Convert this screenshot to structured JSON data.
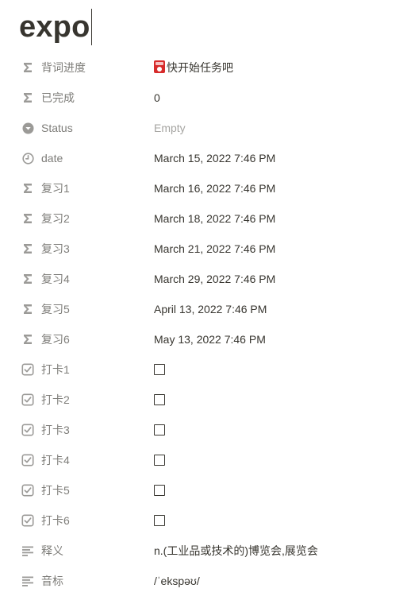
{
  "page": {
    "title": "expo"
  },
  "properties": [
    {
      "label": "背词进度",
      "icon": "sigma-icon",
      "value": "快开始任务吧",
      "has_emoji": true,
      "emoji": "🧧"
    },
    {
      "label": "已完成",
      "icon": "sigma-icon",
      "value": "0"
    },
    {
      "label": "Status",
      "icon": "status-icon",
      "value": "Empty"
    },
    {
      "label": "date",
      "icon": "clock-icon",
      "value": "March 15, 2022 7:46 PM"
    },
    {
      "label": "复习1",
      "icon": "sigma-icon",
      "value": "March 16, 2022 7:46 PM"
    },
    {
      "label": "复习2",
      "icon": "sigma-icon",
      "value": "March 18, 2022 7:46 PM"
    },
    {
      "label": "复习3",
      "icon": "sigma-icon",
      "value": "March 21, 2022 7:46 PM"
    },
    {
      "label": "复习4",
      "icon": "sigma-icon",
      "value": "March 29, 2022 7:46 PM"
    },
    {
      "label": "复习5",
      "icon": "sigma-icon",
      "value": "April 13, 2022 7:46 PM"
    },
    {
      "label": "复习6",
      "icon": "sigma-icon",
      "value": "May 13, 2022 7:46 PM"
    },
    {
      "label": "打卡1",
      "icon": "checkbox-icon",
      "checked": false
    },
    {
      "label": "打卡2",
      "icon": "checkbox-icon",
      "checked": false
    },
    {
      "label": "打卡3",
      "icon": "checkbox-icon",
      "checked": false
    },
    {
      "label": "打卡4",
      "icon": "checkbox-icon",
      "checked": false
    },
    {
      "label": "打卡5",
      "icon": "checkbox-icon",
      "checked": false
    },
    {
      "label": "打卡6",
      "icon": "checkbox-icon",
      "checked": false
    },
    {
      "label": "释义",
      "icon": "text-icon",
      "value": "n.(工业品或技术的)博览会,展览会"
    },
    {
      "label": "音标",
      "icon": "text-icon",
      "value": "/ˈekspəʊ/"
    }
  ]
}
